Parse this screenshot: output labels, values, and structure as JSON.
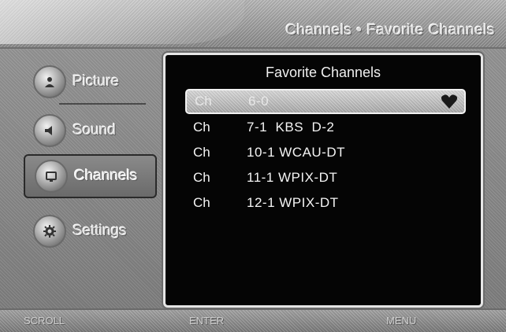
{
  "header": {
    "breadcrumb": "Channels • Favorite Channels"
  },
  "sidebar": {
    "items": [
      {
        "label": "Picture",
        "icon": "picture-icon"
      },
      {
        "label": "Sound",
        "icon": "speaker-icon"
      },
      {
        "label": "Channels",
        "icon": "tv-icon",
        "selected": true
      },
      {
        "label": "Settings",
        "icon": "gear-icon"
      }
    ]
  },
  "panel": {
    "title": "Favorite Channels",
    "rows": [
      {
        "prefix": "Ch",
        "name": "6-0",
        "highlighted": true,
        "favorite": true
      },
      {
        "prefix": "Ch",
        "name": "7-1  KBS  D-2"
      },
      {
        "prefix": "Ch",
        "name": "10-1 WCAU-DT"
      },
      {
        "prefix": "Ch",
        "name": "11-1 WPIX-DT"
      },
      {
        "prefix": "Ch",
        "name": "12-1 WPIX-DT"
      }
    ]
  },
  "footer": {
    "left_hint": "SCROLL",
    "center_hint": "ENTER",
    "right_hint": "MENU"
  },
  "colors": {
    "panel_bg": "#050505",
    "panel_border": "#e6e6e6",
    "text": "#f4f4f4",
    "chrome": "#8e8e8e"
  }
}
